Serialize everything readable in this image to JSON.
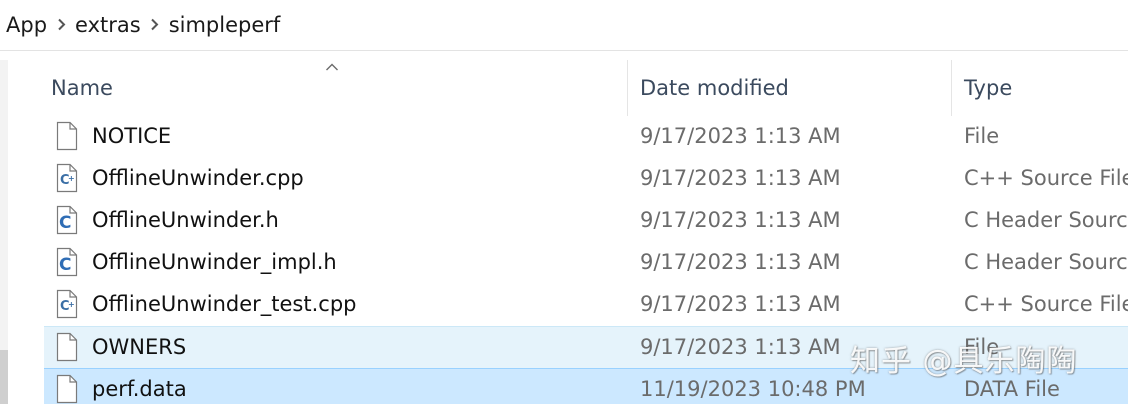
{
  "breadcrumb": {
    "items": [
      "App",
      "extras",
      "simpleperf"
    ],
    "separator_icon": "chevron-right-icon"
  },
  "columns": {
    "name": "Name",
    "date": "Date modified",
    "type": "Type",
    "sort_icon": "sort-ascending-icon"
  },
  "files": [
    {
      "name": "NOTICE",
      "date": "9/17/2023 1:13 AM",
      "type": "File",
      "icon": "blank-file-icon",
      "state": "normal"
    },
    {
      "name": "OfflineUnwinder.cpp",
      "date": "9/17/2023 1:13 AM",
      "type": "C++ Source File",
      "icon": "cpp-file-icon",
      "state": "normal"
    },
    {
      "name": "OfflineUnwinder.h",
      "date": "9/17/2023 1:13 AM",
      "type": "C Header Source",
      "icon": "c-header-file-icon",
      "state": "normal"
    },
    {
      "name": "OfflineUnwinder_impl.h",
      "date": "9/17/2023 1:13 AM",
      "type": "C Header Source",
      "icon": "c-header-file-icon",
      "state": "normal"
    },
    {
      "name": "OfflineUnwinder_test.cpp",
      "date": "9/17/2023 1:13 AM",
      "type": "C++ Source File",
      "icon": "cpp-file-icon",
      "state": "normal"
    },
    {
      "name": "OWNERS",
      "date": "9/17/2023 1:13 AM",
      "type": "File",
      "icon": "blank-file-icon",
      "state": "hover"
    },
    {
      "name": "perf.data",
      "date": "11/19/2023 10:48 PM",
      "type": "DATA File",
      "icon": "blank-file-icon",
      "state": "selected"
    }
  ],
  "watermark": "知乎 @具乐陶陶",
  "colors": {
    "hover_row": "#e5f3fb",
    "selected_row": "#cce8ff",
    "header_text": "#3b4a5e",
    "secondary_text": "#6b6b6b",
    "cpp_icon": "#3a6ea5",
    "c_icon": "#2f6db5"
  }
}
